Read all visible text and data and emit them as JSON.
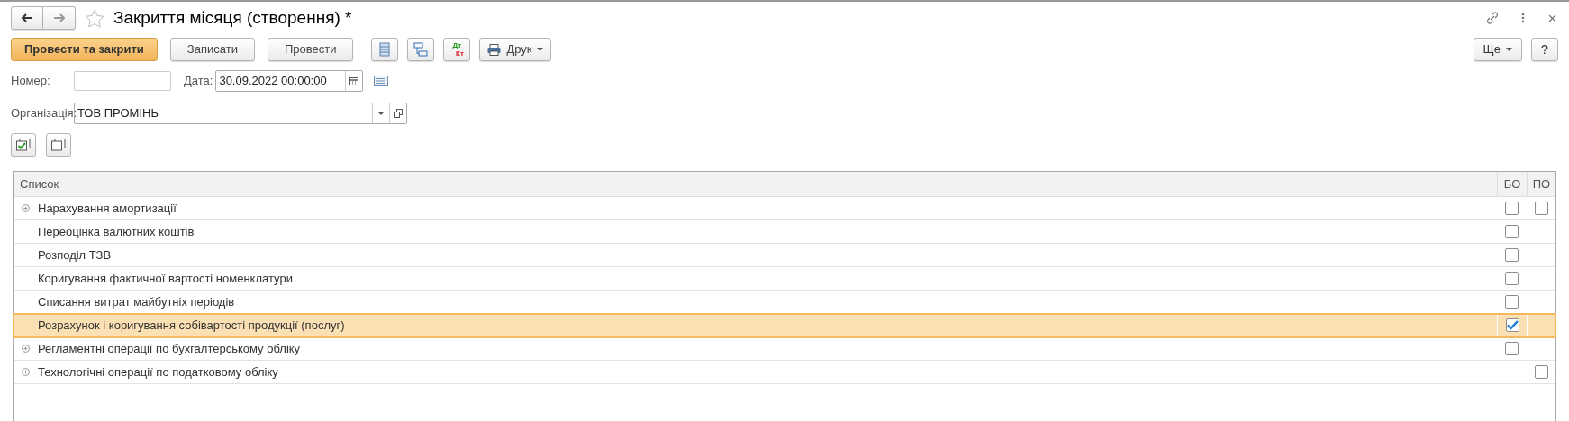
{
  "window": {
    "title": "Закриття місяця (створення) *"
  },
  "toolbar": {
    "buttons": [
      {
        "label": "Провести та закрити",
        "kind": "primary"
      },
      {
        "label": "Записати",
        "kind": "normal"
      },
      {
        "label": "Провести",
        "kind": "normal"
      }
    ],
    "dt_kt_icon": {
      "top": "Дт",
      "bottom": "Кт"
    },
    "print_menu": "Друк",
    "more_menu": "Ще",
    "help": "?"
  },
  "fields": {
    "number": {
      "label": "Номер:"
    },
    "date": {
      "label": "Дата:",
      "value": "30.09.2022 00:00:00"
    },
    "organization": {
      "label": "Організація:",
      "value": "ТОВ ПРОМІНЬ"
    }
  },
  "table": {
    "columns": [
      "Список",
      "БО",
      "ПО"
    ],
    "rows": [
      {
        "name": "Нарахування амортизації",
        "expandable": true,
        "selected": false,
        "bo": false,
        "po": false
      },
      {
        "name": "Переоцінка валютних коштів",
        "expandable": false,
        "selected": false,
        "bo": false
      },
      {
        "name": "Розподіл ТЗВ",
        "expandable": false,
        "selected": false,
        "bo": false
      },
      {
        "name": "Коригування фактичної вартості номенклатури",
        "expandable": false,
        "selected": false,
        "bo": false
      },
      {
        "name": "Списання витрат майбутніх періодів",
        "expandable": false,
        "selected": false,
        "bo": false
      },
      {
        "name": "Розрахунок і коригування собівартості продукції (послуг)",
        "expandable": false,
        "selected": true,
        "bo": true
      },
      {
        "name": "Регламентні операції по бухгалтерському обліку",
        "expandable": true,
        "selected": false,
        "bo": false
      },
      {
        "name": "Технологічні операції по податковому обліку",
        "expandable": true,
        "selected": false,
        "po": false
      }
    ]
  }
}
